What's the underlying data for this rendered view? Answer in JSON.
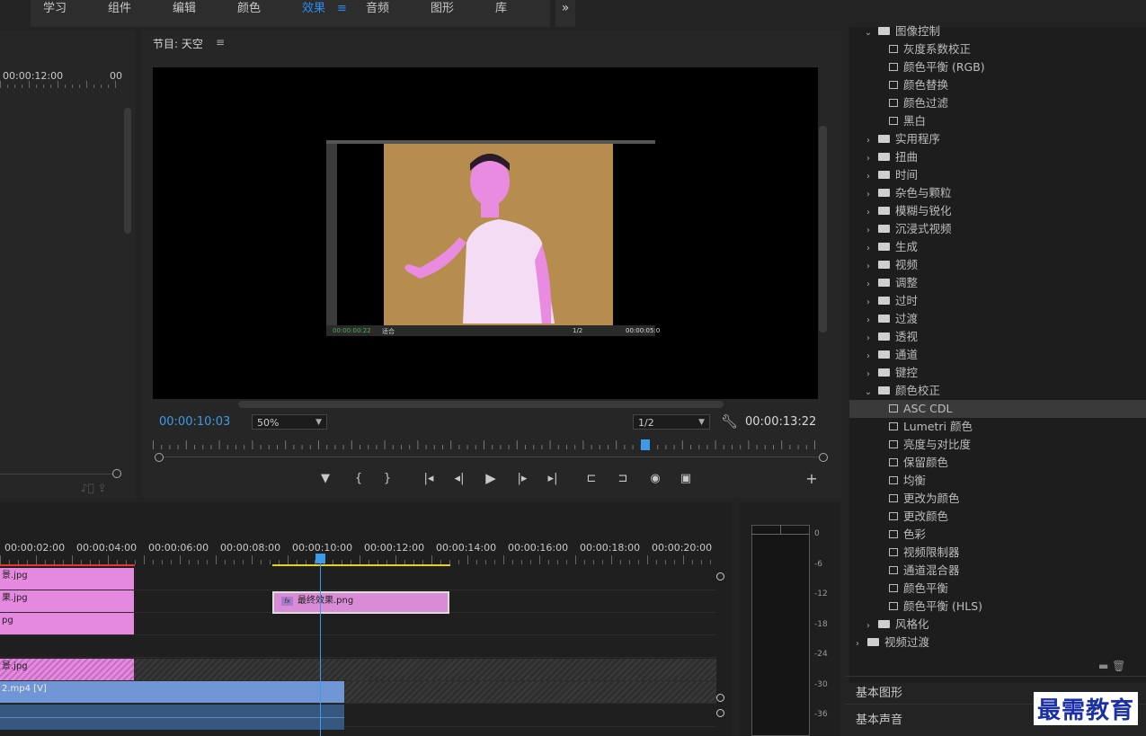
{
  "workspace_tabs": [
    "学习",
    "组件",
    "编辑",
    "颜色",
    "效果",
    "音频",
    "图形",
    "库"
  ],
  "workspace_active": "效果",
  "workspace_menu_icon": "≡",
  "workspace_more_icon": "»",
  "source": {
    "tc_a": "00:00:12:00",
    "tc_b": "00"
  },
  "program": {
    "title": "节目: 天空",
    "menu_icon": "≡",
    "timecode_current": "00:00:10:03",
    "zoom": "50%",
    "resolution": "1/2",
    "timecode_duration": "00:00:13:22",
    "inner_tc": "00:00:00:22",
    "inner_zoom": "适合",
    "inner_res": "1/2",
    "inner_dur": "00:00:05:0",
    "controls": [
      "▼",
      "{",
      "}",
      "|◂",
      "◂|",
      "▶",
      "|▸",
      "▸|",
      "⊏",
      "⊐",
      "◉",
      "▣",
      "+"
    ]
  },
  "effects_list": [
    {
      "label": "图像控制",
      "type": "folder",
      "open": true,
      "indent": 1
    },
    {
      "label": "灰度系数校正",
      "type": "fx",
      "indent": 2
    },
    {
      "label": "颜色平衡 (RGB)",
      "type": "fx",
      "indent": 2
    },
    {
      "label": "颜色替换",
      "type": "fx",
      "indent": 2
    },
    {
      "label": "颜色过滤",
      "type": "fx",
      "indent": 2
    },
    {
      "label": "黑白",
      "type": "fx",
      "indent": 2
    },
    {
      "label": "实用程序",
      "type": "folder",
      "open": false,
      "indent": 1
    },
    {
      "label": "扭曲",
      "type": "folder",
      "open": false,
      "indent": 1
    },
    {
      "label": "时间",
      "type": "folder",
      "open": false,
      "indent": 1
    },
    {
      "label": "杂色与颗粒",
      "type": "folder",
      "open": false,
      "indent": 1
    },
    {
      "label": "模糊与锐化",
      "type": "folder",
      "open": false,
      "indent": 1
    },
    {
      "label": "沉浸式视频",
      "type": "folder",
      "open": false,
      "indent": 1
    },
    {
      "label": "生成",
      "type": "folder",
      "open": false,
      "indent": 1
    },
    {
      "label": "视频",
      "type": "folder",
      "open": false,
      "indent": 1
    },
    {
      "label": "调整",
      "type": "folder",
      "open": false,
      "indent": 1
    },
    {
      "label": "过时",
      "type": "folder",
      "open": false,
      "indent": 1
    },
    {
      "label": "过渡",
      "type": "folder",
      "open": false,
      "indent": 1
    },
    {
      "label": "透视",
      "type": "folder",
      "open": false,
      "indent": 1
    },
    {
      "label": "通道",
      "type": "folder",
      "open": false,
      "indent": 1
    },
    {
      "label": "键控",
      "type": "folder",
      "open": false,
      "indent": 1
    },
    {
      "label": "颜色校正",
      "type": "folder",
      "open": true,
      "indent": 1
    },
    {
      "label": "ASC CDL",
      "type": "fx",
      "indent": 2,
      "selected": true
    },
    {
      "label": "Lumetri 颜色",
      "type": "fx",
      "indent": 2
    },
    {
      "label": "亮度与对比度",
      "type": "fx",
      "indent": 2
    },
    {
      "label": "保留颜色",
      "type": "fx",
      "indent": 2
    },
    {
      "label": "均衡",
      "type": "fx",
      "indent": 2
    },
    {
      "label": "更改为颜色",
      "type": "fx",
      "indent": 2
    },
    {
      "label": "更改颜色",
      "type": "fx",
      "indent": 2
    },
    {
      "label": "色彩",
      "type": "fx",
      "indent": 2
    },
    {
      "label": "视频限制器",
      "type": "fx",
      "indent": 2
    },
    {
      "label": "通道混合器",
      "type": "fx",
      "indent": 2
    },
    {
      "label": "颜色平衡",
      "type": "fx",
      "indent": 2
    },
    {
      "label": "颜色平衡 (HLS)",
      "type": "fx",
      "indent": 2
    },
    {
      "label": "风格化",
      "type": "folder",
      "open": false,
      "indent": 1
    },
    {
      "label": "视频过渡",
      "type": "folder",
      "open": false,
      "indent": 0
    }
  ],
  "panels": {
    "basic_graphics": "基本图形",
    "basic_audio": "基本声音"
  },
  "timeline": {
    "timecodes": [
      "00:00:02:00",
      "00:00:04:00",
      "00:00:06:00",
      "00:00:08:00",
      "00:00:10:00",
      "00:00:12:00",
      "00:00:14:00",
      "00:00:16:00",
      "00:00:18:00",
      "00:00:20:00"
    ],
    "clips": {
      "v_a": "景.jpg",
      "v_b": "果.jpg",
      "v_c": "pg",
      "v_d": "景.jpg",
      "v_e": "2.mp4 [V]",
      "selected_clip": "最终效果.png",
      "fx_badge": "fx"
    }
  },
  "meter_db": [
    "0",
    "-6",
    "-12",
    "-18",
    "-24",
    "-30",
    "-36"
  ],
  "watermark": "最需教育",
  "colors": {
    "accent": "#2d8ceb",
    "clip_pink": "#e588e0",
    "clip_blue": "#7196d6",
    "bg_image": "#b68d4e",
    "work_area": "#e6d12b"
  }
}
